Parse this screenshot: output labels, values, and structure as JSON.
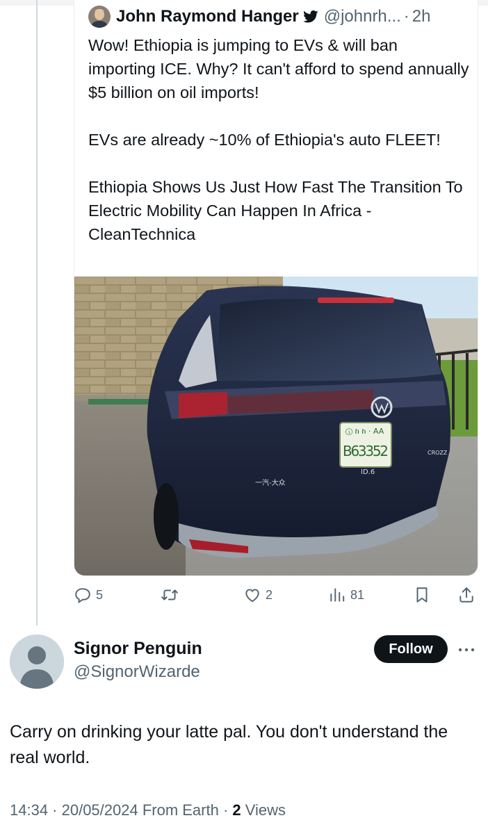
{
  "quoted_tweet": {
    "author_name": "John Raymond Hanger",
    "handle": "@johnrh...",
    "separator": "·",
    "time": "2h",
    "paragraphs": [
      "Wow! Ethiopia is jumping to EVs & will ban importing ICE. Why? It can't afford to spend annually $5 billion on oil imports!",
      "EVs are already ~10% of Ethiopia's auto FLEET!",
      "Ethiopia Shows Us Just How Fast The Transition To Electric Mobility Can Happen In Africa - CleanTechnica"
    ],
    "photo": {
      "plate_top": "ⓘ ከ ከ · AA",
      "plate_number": "B63352",
      "badge": "ID.6",
      "dealer_text": "一汽-大众",
      "side_badge": "CROZZ"
    },
    "icons": {
      "verified": "bird-icon"
    }
  },
  "actions": {
    "reply_count": "5",
    "retweet_count": "",
    "like_count": "2",
    "view_count": "81"
  },
  "reply": {
    "name": "Signor Penguin",
    "handle": "@SignorWizarde",
    "follow_label": "Follow",
    "text": "Carry on drinking your latte pal. You don't understand the real world.",
    "meta_time": "14:34 · 20/05/2024 From Earth · ",
    "meta_views_count": "2",
    "meta_views_label": " Views"
  },
  "colors": {
    "text": "#0f1419",
    "secondary": "#536471",
    "follow_bg": "#0f1419",
    "thread_line": "#cfd9de"
  }
}
